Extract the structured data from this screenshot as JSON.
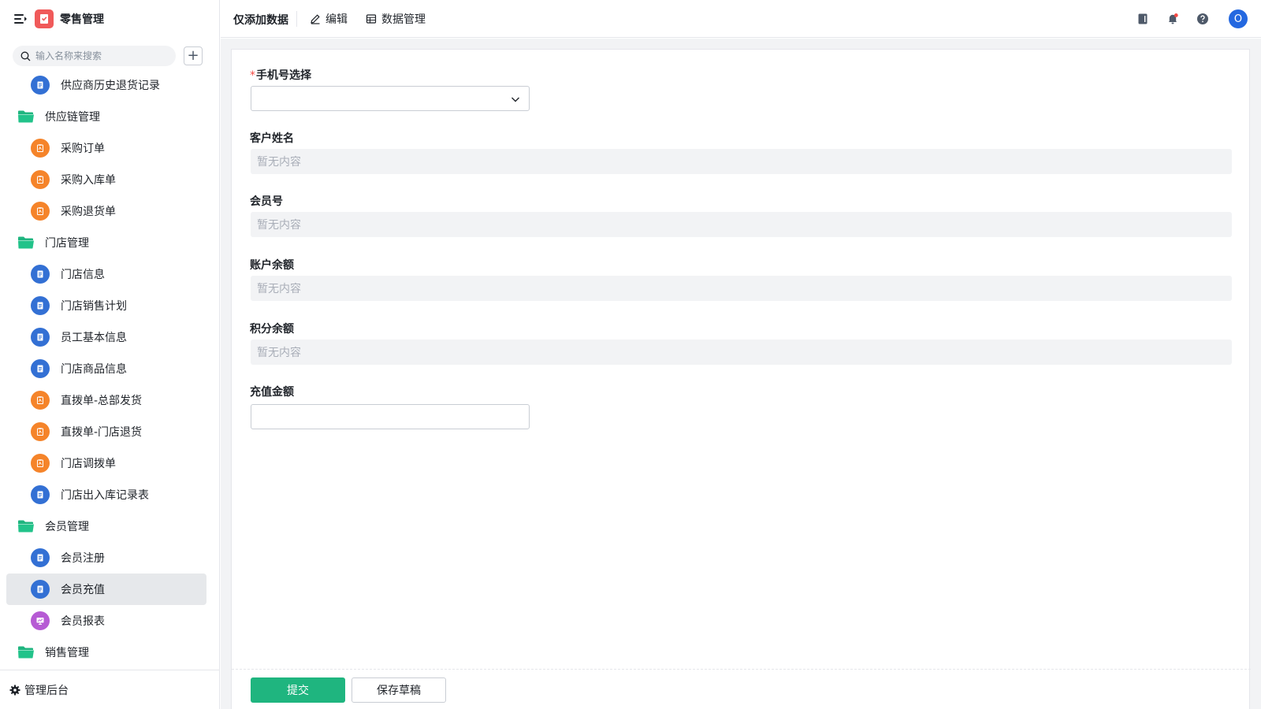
{
  "app": {
    "title": "零售管理",
    "colors": {
      "accent": "#1fb57f",
      "logo": "#f05a5a",
      "icon_blue": "#3370d4",
      "icon_orange": "#f5842a",
      "icon_purple": "#b65bd4",
      "folder": "#1fb57f",
      "avatar": "#2468e0"
    }
  },
  "sidebar": {
    "search_placeholder": "输入名称来搜索",
    "add_label": "+",
    "items": [
      {
        "label": "供应商历史退货记录",
        "type": "child",
        "icon": "document-icon",
        "color": "blue"
      },
      {
        "label": "供应链管理",
        "type": "folder",
        "icon": "folder-icon"
      },
      {
        "label": "采购订单",
        "type": "child",
        "icon": "clipboard-icon",
        "color": "orange"
      },
      {
        "label": "采购入库单",
        "type": "child",
        "icon": "clipboard-icon",
        "color": "orange"
      },
      {
        "label": "采购退货单",
        "type": "child",
        "icon": "clipboard-icon",
        "color": "orange"
      },
      {
        "label": "门店管理",
        "type": "folder",
        "icon": "folder-icon"
      },
      {
        "label": "门店信息",
        "type": "child",
        "icon": "document-icon",
        "color": "blue"
      },
      {
        "label": "门店销售计划",
        "type": "child",
        "icon": "document-icon",
        "color": "blue"
      },
      {
        "label": "员工基本信息",
        "type": "child",
        "icon": "document-icon",
        "color": "blue"
      },
      {
        "label": "门店商品信息",
        "type": "child",
        "icon": "document-icon",
        "color": "blue"
      },
      {
        "label": "直拨单-总部发货",
        "type": "child",
        "icon": "clipboard-icon",
        "color": "orange"
      },
      {
        "label": "直拨单-门店退货",
        "type": "child",
        "icon": "clipboard-icon",
        "color": "orange"
      },
      {
        "label": "门店调拨单",
        "type": "child",
        "icon": "clipboard-icon",
        "color": "orange"
      },
      {
        "label": "门店出入库记录表",
        "type": "child",
        "icon": "document-icon",
        "color": "blue"
      },
      {
        "label": "会员管理",
        "type": "folder",
        "icon": "folder-icon"
      },
      {
        "label": "会员注册",
        "type": "child",
        "icon": "document-icon",
        "color": "blue"
      },
      {
        "label": "会员充值",
        "type": "child",
        "icon": "document-icon",
        "color": "blue",
        "active": true
      },
      {
        "label": "会员报表",
        "type": "child",
        "icon": "report-icon",
        "color": "purple"
      },
      {
        "label": "销售管理",
        "type": "folder",
        "icon": "folder-icon"
      }
    ],
    "footer_label": "管理后台"
  },
  "topbar": {
    "title": "仅添加数据",
    "edit_label": "编辑",
    "data_manage_label": "数据管理",
    "avatar_initial": "O"
  },
  "form": {
    "fields": [
      {
        "label": "手机号选择",
        "required": true,
        "kind": "select",
        "value": ""
      },
      {
        "label": "客户姓名",
        "kind": "readonly",
        "value": "暂无内容"
      },
      {
        "label": "会员号",
        "kind": "readonly",
        "value": "暂无内容"
      },
      {
        "label": "账户余额",
        "kind": "readonly",
        "value": "暂无内容"
      },
      {
        "label": "积分余额",
        "kind": "readonly",
        "value": "暂无内容"
      },
      {
        "label": "充值金额",
        "kind": "input",
        "value": ""
      }
    ],
    "submit_label": "提交",
    "draft_label": "保存草稿"
  }
}
